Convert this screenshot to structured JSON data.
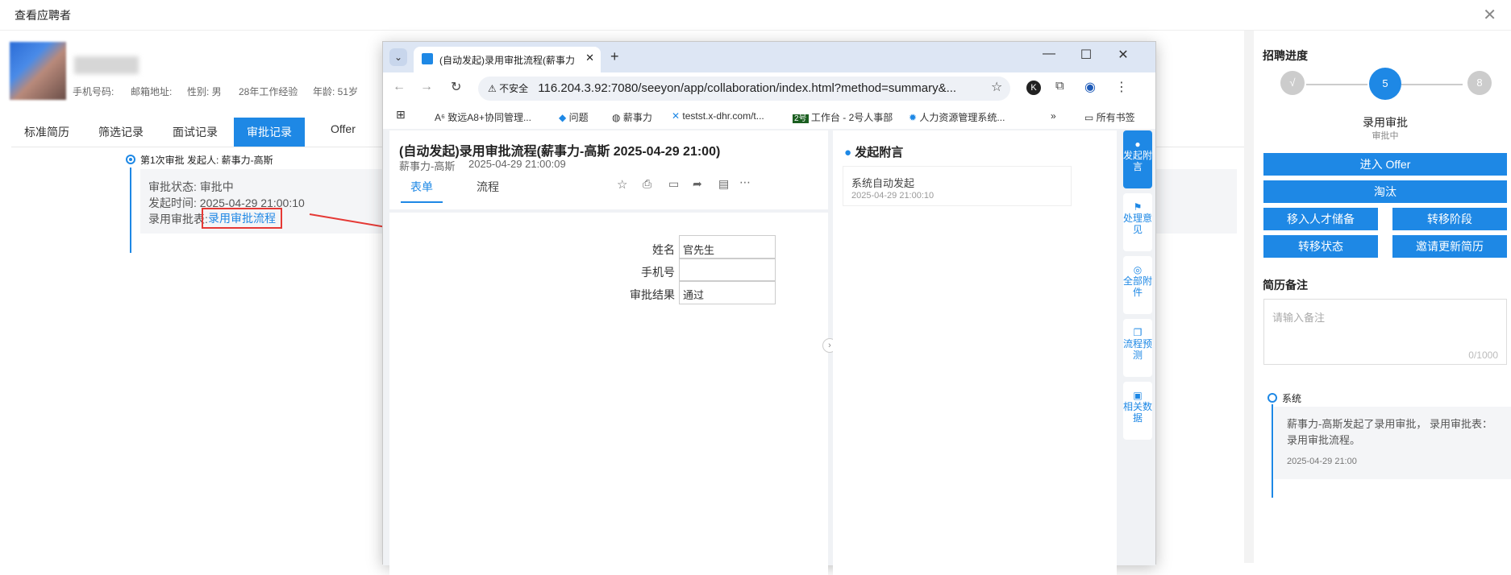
{
  "page": {
    "title": "查看应聘者"
  },
  "candidate": {
    "phone_label": "手机号码:",
    "email_label": "邮箱地址:",
    "gender": "性别: 男",
    "experience": "28年工作经验",
    "age": "年龄: 51岁"
  },
  "tabs": [
    "标准简历",
    "筛选记录",
    "面试记录",
    "审批记录",
    "Offer"
  ],
  "record": {
    "title": "第1次审批 发起人: 薪事力-高斯",
    "status": "审批状态: 审批中",
    "time": "发起时间: 2025-04-29 21:00:10",
    "form_label": "录用审批表:",
    "form_link": "录用审批流程"
  },
  "browser": {
    "tab_title": "(自动发起)录用审批流程(薪事力",
    "security": "不安全",
    "url": "116.204.3.92:7080/seeyon/app/collaboration/index.html?method=summary&...",
    "bookmarks": [
      "致远A8+协同管理...",
      "问题",
      "薪事力",
      "testst.x-dhr.com/t...",
      "工作台 - 2号人事部",
      "人力资源管理系统...",
      "所有书签"
    ],
    "form_title": "(自动发起)录用审批流程(薪事力-高斯 2025-04-29 21:00)",
    "form_sub_author": "薪事力-高斯",
    "form_sub_time": "2025-04-29 21:00:09",
    "form_tabs": [
      "表单",
      "流程"
    ],
    "fields": [
      {
        "label": "姓名",
        "value": "官先生"
      },
      {
        "label": "手机号",
        "value": ""
      },
      {
        "label": "审批结果",
        "value": "通过"
      }
    ],
    "side_title": "发起附言",
    "side_note": "系统自动发起",
    "side_note_time": "2025-04-29 21:00:10",
    "rail": [
      "发起附言",
      "处理意见",
      "全部附件",
      "流程预测",
      "相关数据"
    ]
  },
  "right": {
    "progress_title": "招聘进度",
    "steps": [
      "√",
      "5",
      "8"
    ],
    "current_step": "录用审批",
    "current_status": "审批中",
    "buttons": {
      "enter_offer": "进入 Offer",
      "eliminate": "淘汰",
      "talent_pool": "移入人才储备",
      "move_stage": "转移阶段",
      "move_status": "转移状态",
      "invite_update": "邀请更新简历"
    },
    "note_title": "简历备注",
    "note_placeholder": "请输入备注",
    "note_count": "0/1000",
    "log_source": "系统",
    "log_text": "薪事力-高斯发起了录用审批， 录用审批表：录用审批流程。",
    "log_time": "2025-04-29 21:00"
  }
}
